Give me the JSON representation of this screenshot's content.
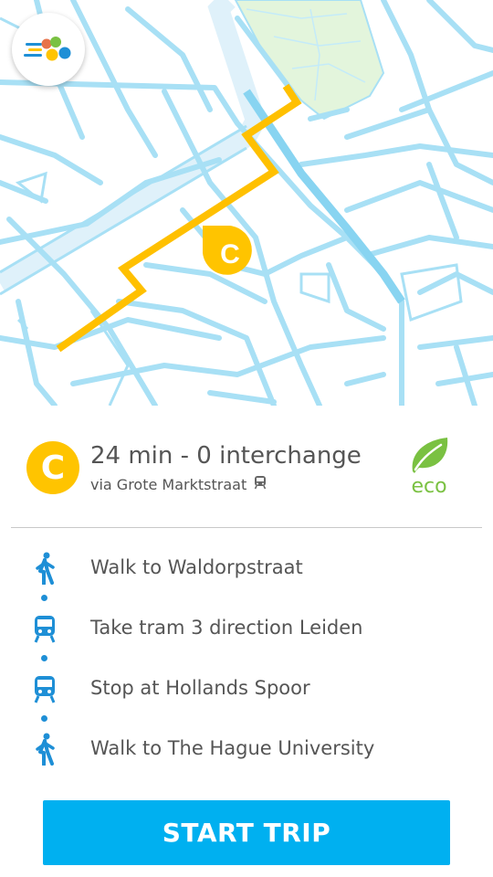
{
  "map": {
    "route_marker_letter": "C",
    "colors": {
      "streets": "#a8e0f5",
      "canal": "#dff1fa",
      "park": "#e3f5dc",
      "route": "#ffc000"
    }
  },
  "menu": {
    "icon": "app-logo-icon"
  },
  "summary": {
    "route_letter": "C",
    "duration_text": "24 min - 0 interchange",
    "via_text": "via Grote Marktstraat",
    "via_icon": "tram-icon",
    "eco_label": "eco",
    "eco_icon": "leaf-icon",
    "accent_color": "#ffc400"
  },
  "steps": [
    {
      "icon": "walk-icon",
      "text": "Walk to Waldorpstraat"
    },
    {
      "icon": "tram-icon",
      "text": "Take tram 3 direction Leiden"
    },
    {
      "icon": "tram-icon",
      "text": "Stop at Hollands Spoor"
    },
    {
      "icon": "walk-icon",
      "text": "Walk to The Hague University"
    }
  ],
  "start_button": {
    "label": "START TRIP",
    "color": "#00b0f0"
  }
}
